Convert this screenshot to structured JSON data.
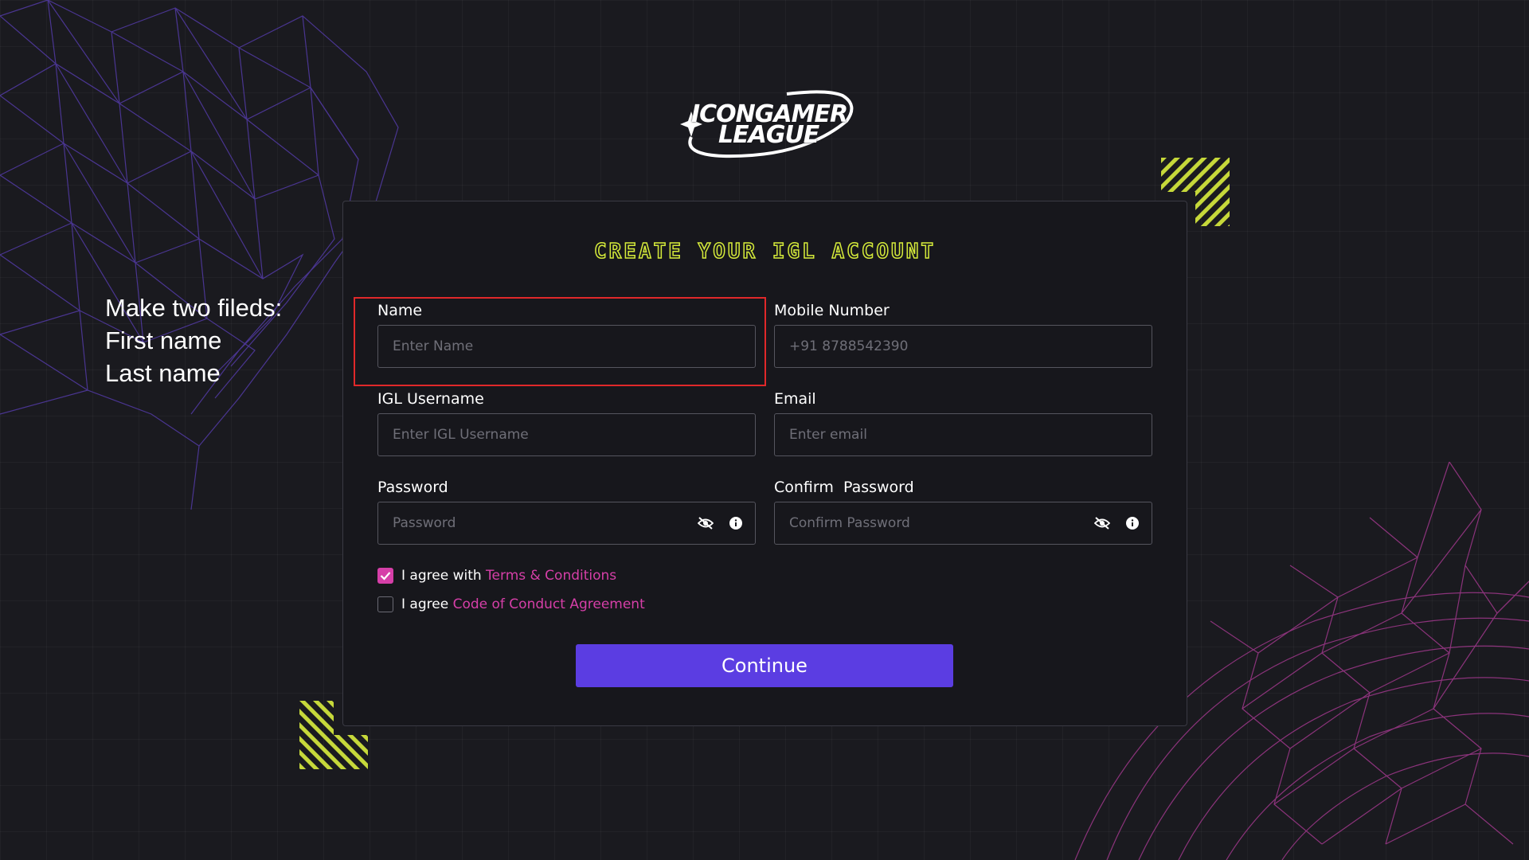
{
  "logo": {
    "line1": "ICONGAMER",
    "line2": "LEAGUE"
  },
  "form": {
    "title": "CREATE YOUR IGL ACCOUNT",
    "fields": {
      "name": {
        "label": "Name",
        "placeholder": "Enter Name"
      },
      "mobile": {
        "label": "Mobile Number",
        "placeholder": "+91 8788542390"
      },
      "username": {
        "label": "IGL Username",
        "placeholder": "Enter IGL Username"
      },
      "email": {
        "label": "Email",
        "placeholder": "Enter email"
      },
      "password": {
        "label": "Password",
        "placeholder": "Password"
      },
      "confirm_password": {
        "label": "Confirm  Password",
        "placeholder": "Confirm Password"
      }
    },
    "terms": {
      "checked": true,
      "prefix": "I agree with",
      "link": "Terms & Conditions"
    },
    "conduct": {
      "checked": false,
      "prefix": "I agree",
      "link": "Code of Conduct Agreement"
    },
    "continue_label": "Continue"
  },
  "annotation": {
    "line1": "Make two fileds:",
    "line2": "First name",
    "line3": "Last name"
  },
  "colors": {
    "background": "#1a1a1f",
    "accent_lime": "#d4e93a",
    "accent_pink": "#d63fa8",
    "button_purple": "#5b3de2",
    "highlight_red": "#e0282a"
  }
}
